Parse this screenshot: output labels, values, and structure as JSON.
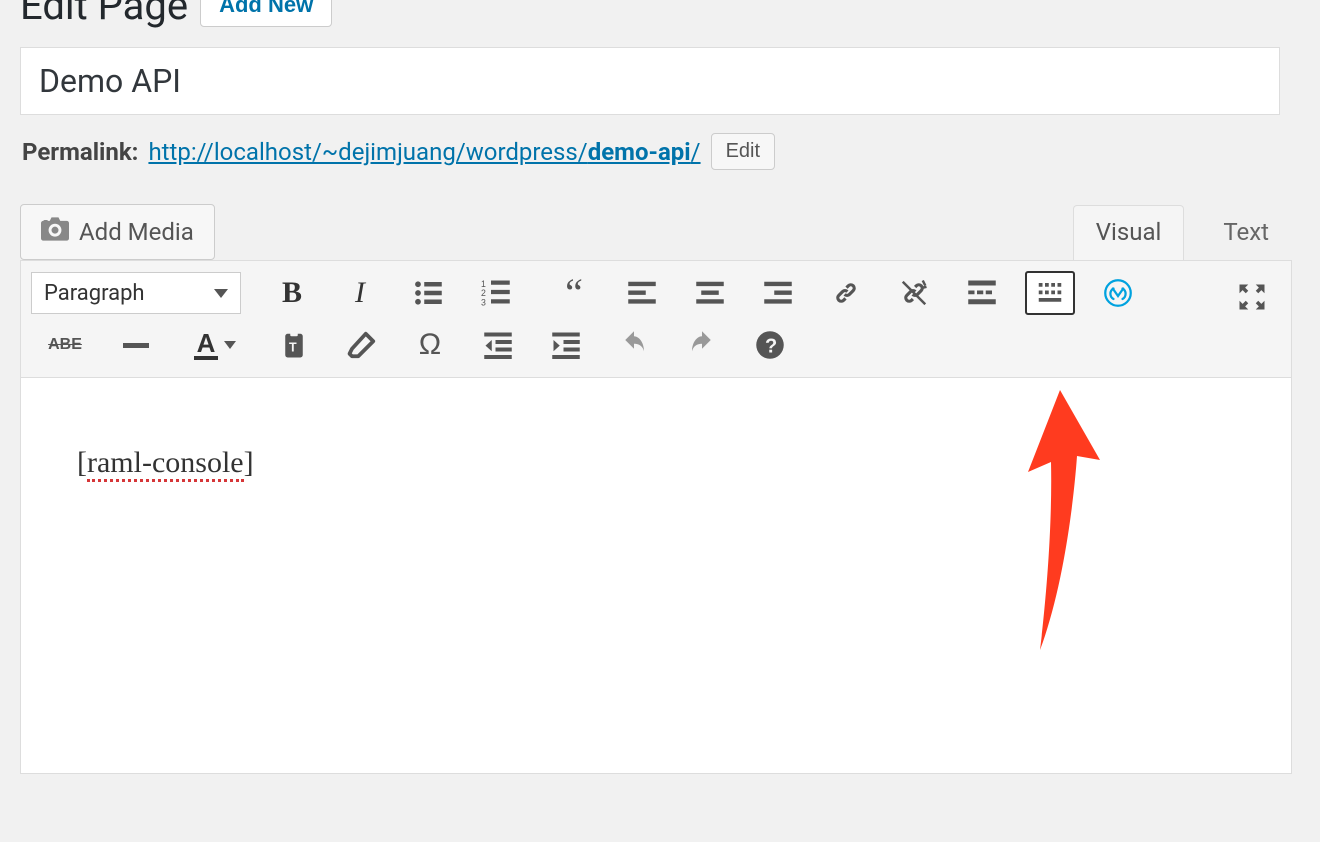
{
  "header": {
    "page_heading": "Edit Page",
    "add_new_label": "Add New"
  },
  "post": {
    "title": "Demo API"
  },
  "permalink": {
    "label": "Permalink:",
    "base_url": "http://localhost/~dejimjuang/wordpress/",
    "slug": "demo-api",
    "trailing": "/",
    "edit_label": "Edit"
  },
  "media": {
    "add_media_label": "Add Media"
  },
  "tabs": {
    "visual": "Visual",
    "text": "Text",
    "active": "visual"
  },
  "toolbar": {
    "format_selector": "Paragraph",
    "row1": [
      {
        "name": "bold-button",
        "icon": "bold"
      },
      {
        "name": "italic-button",
        "icon": "italic"
      },
      {
        "name": "bulleted-list-button",
        "icon": "ul"
      },
      {
        "name": "numbered-list-button",
        "icon": "ol"
      },
      {
        "name": "blockquote-button",
        "icon": "quote"
      },
      {
        "name": "align-left-button",
        "icon": "align-left"
      },
      {
        "name": "align-center-button",
        "icon": "align-center"
      },
      {
        "name": "align-right-button",
        "icon": "align-right"
      },
      {
        "name": "insert-link-button",
        "icon": "link"
      },
      {
        "name": "unlink-button",
        "icon": "unlink"
      },
      {
        "name": "insert-more-button",
        "icon": "readmore"
      },
      {
        "name": "toolbar-toggle-button",
        "icon": "kitchensink"
      },
      {
        "name": "mulesoft-api-button",
        "icon": "mulesoft"
      }
    ],
    "fullscreen": {
      "name": "fullscreen-button",
      "icon": "fullscreen"
    },
    "row2": [
      {
        "name": "strikethrough-button",
        "icon": "abc"
      },
      {
        "name": "horizontal-rule-button",
        "icon": "hr"
      },
      {
        "name": "text-color-button",
        "icon": "textcolor"
      },
      {
        "name": "paste-text-button",
        "icon": "paste"
      },
      {
        "name": "clear-formatting-button",
        "icon": "eraser"
      },
      {
        "name": "special-character-button",
        "icon": "omega"
      },
      {
        "name": "outdent-button",
        "icon": "outdent"
      },
      {
        "name": "indent-button",
        "icon": "indent"
      },
      {
        "name": "undo-button",
        "icon": "undo"
      },
      {
        "name": "redo-button",
        "icon": "redo"
      },
      {
        "name": "help-button",
        "icon": "help"
      }
    ]
  },
  "content": {
    "shortcode_open": "[",
    "shortcode_name": "raml-console",
    "shortcode_close": "]"
  },
  "annotation": {
    "arrow_color": "#ff3b1f"
  }
}
